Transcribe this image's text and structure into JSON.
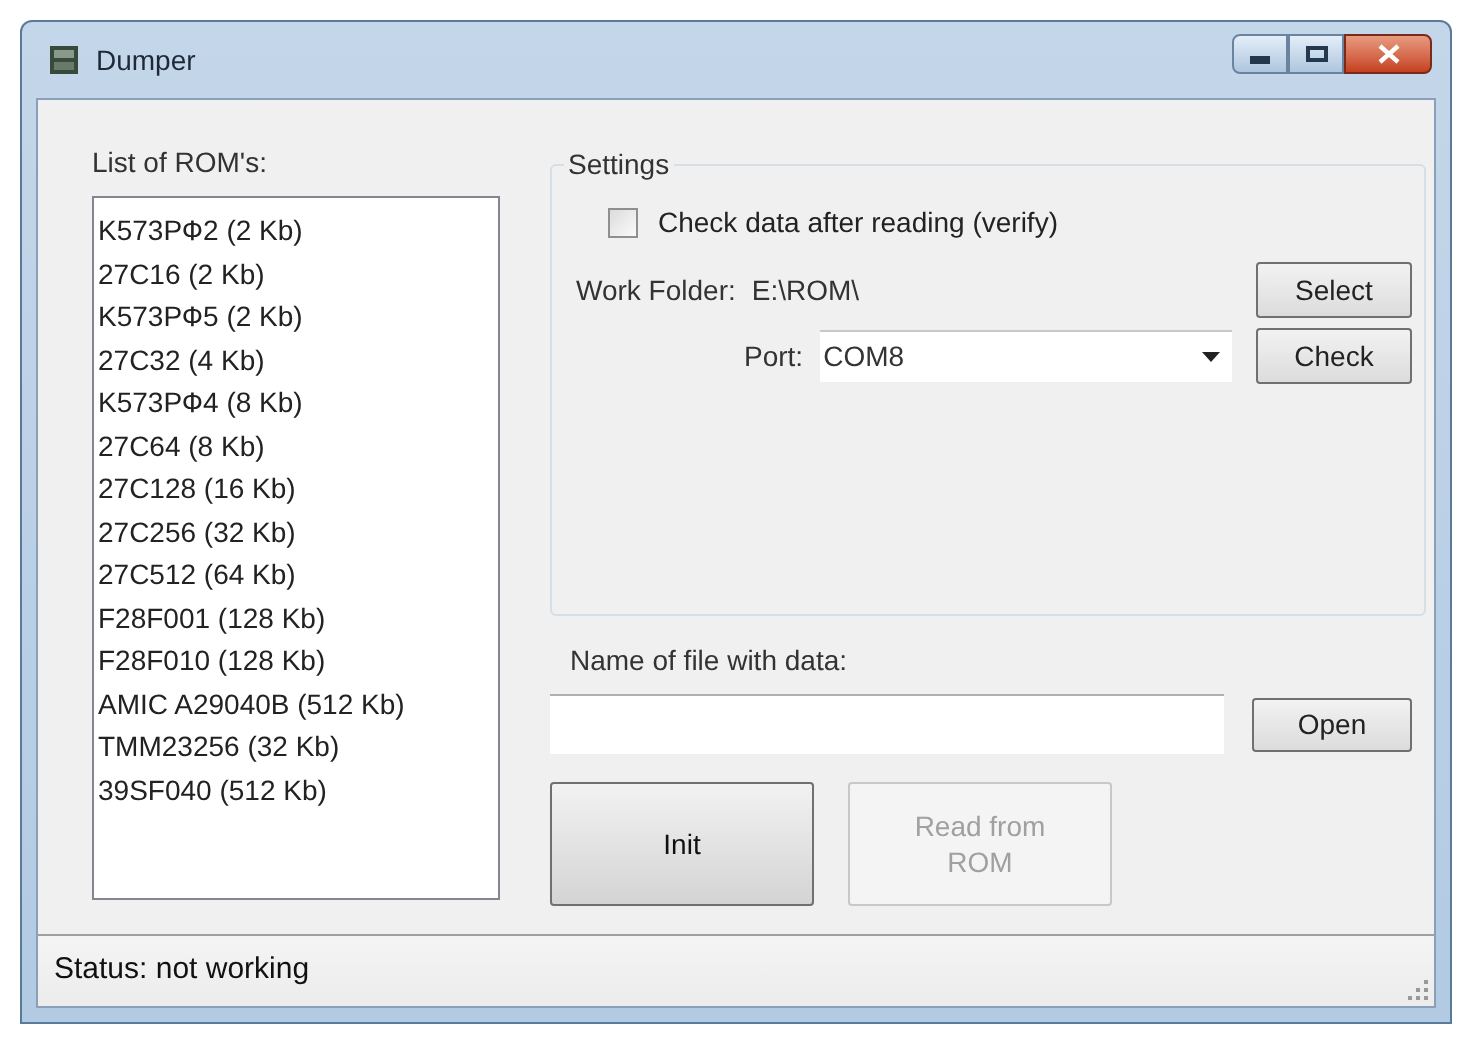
{
  "window": {
    "title": "Dumper"
  },
  "rom_list": {
    "label": "List of ROM's:",
    "items": [
      "K573РФ2 (2 Kb)",
      "27C16 (2 Kb)",
      "K573РФ5 (2 Kb)",
      "27C32 (4 Kb)",
      "K573РФ4 (8 Kb)",
      "27C64 (8 Kb)",
      "27C128 (16 Kb)",
      "27C256 (32 Kb)",
      "27C512 (64 Kb)",
      "F28F001 (128 Kb)",
      "F28F010 (128 Kb)",
      "AMIC A29040B (512 Kb)",
      "TMM23256 (32 Kb)",
      "39SF040 (512 Kb)"
    ]
  },
  "settings": {
    "title": "Settings",
    "verify": {
      "label": "Check data after reading (verify)",
      "checked": false
    },
    "work_folder": {
      "label": "Work Folder:",
      "value": "E:\\ROM\\",
      "button": "Select"
    },
    "port": {
      "label": "Port:",
      "value": "COM8",
      "button": "Check"
    }
  },
  "data_file": {
    "label": "Name of file with data:",
    "button": "Open"
  },
  "actions": [
    {
      "label": "Init",
      "disabled": false
    },
    {
      "label": "Read from ROM",
      "disabled": true
    }
  ],
  "status_bar": {
    "text": "Status: not working"
  }
}
